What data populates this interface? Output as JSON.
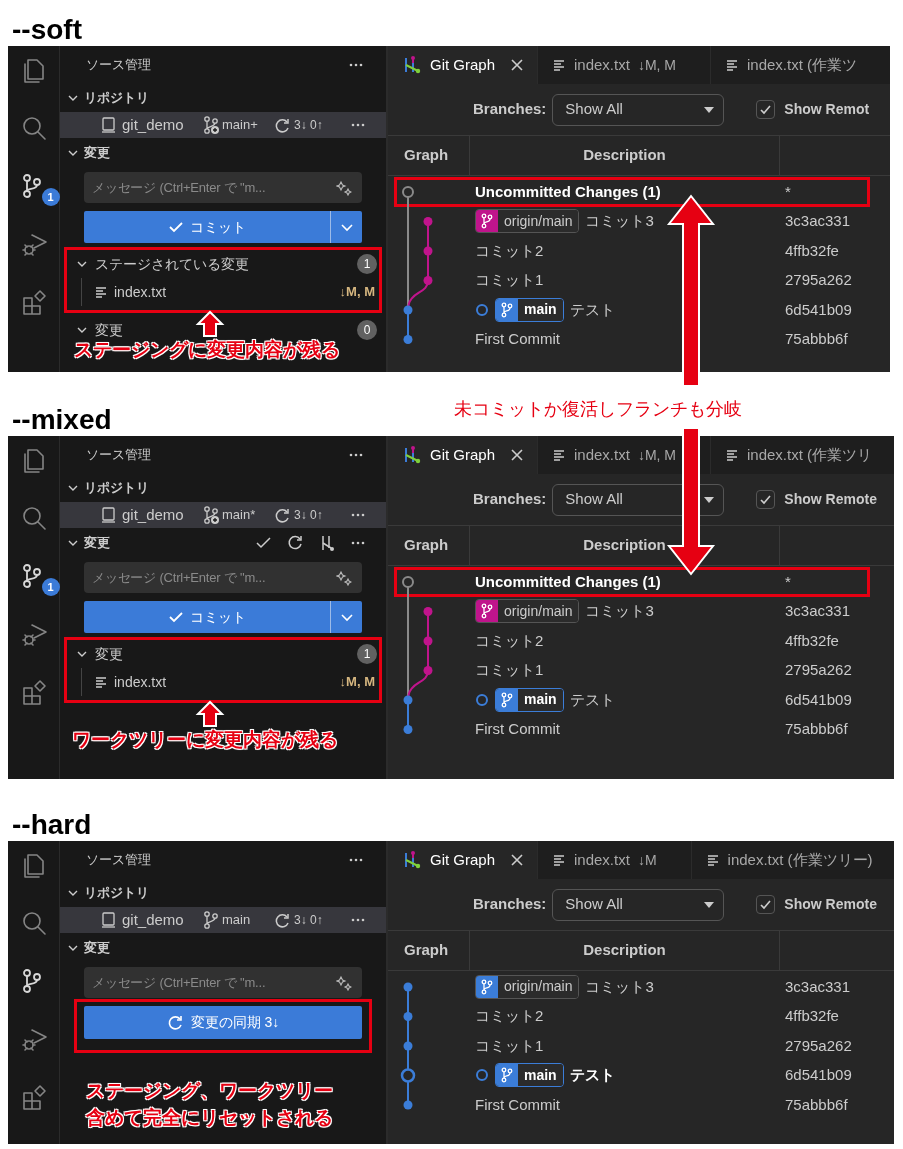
{
  "annotation": "未コミットか復活しフランチも分岐",
  "sections": [
    {
      "heading": "--soft",
      "activity_badge": "1",
      "sidebar": {
        "title": "ソース管理",
        "repositories_header": "リポジトリ",
        "repo": {
          "name": "git_demo",
          "branch": "main+",
          "branch_dirty": true,
          "sync": "3↓ 0↑"
        },
        "changes_header": "変更",
        "header_actions": false,
        "message_placeholder": "メッセージ (Ctrl+Enter で \"m...",
        "button": {
          "kind": "commit",
          "label": "コミット",
          "highlighted": false
        },
        "groups": [
          {
            "title": "ステージされている変更",
            "count": "1",
            "highlighted": true,
            "files": [
              {
                "name": "index.txt",
                "status": "↓M, M"
              }
            ]
          },
          {
            "title": "変更",
            "count": "0",
            "highlighted": false
          }
        ],
        "note": [
          "ステージングに変更内容が残る"
        ]
      },
      "editor": {
        "graph": {
          "kind": "diverged"
        },
        "tabs": [
          {
            "kind": "graph",
            "label": "Git Graph",
            "selected": true
          },
          {
            "kind": "file",
            "label": "index.txt",
            "status": "↓M, M",
            "selected": false
          },
          {
            "kind": "file",
            "label": "index.txt (作業ツ",
            "selected": false
          }
        ],
        "branches_label": "Branches:",
        "branches_value": "Show All",
        "show_remote": {
          "label": "Show Remot",
          "checked": true
        },
        "columns": [
          "Graph",
          "Description"
        ],
        "rows": [
          {
            "description": "Uncommitted Changes (1)",
            "hash": "*",
            "emphasized": true,
            "highlighted": true
          },
          {
            "tag": {
              "label": "origin/main",
              "color": "#c0148c",
              "current": false
            },
            "description": "コミット3",
            "hash": "3c3ac331",
            "emphasized": false,
            "highlighted": false
          },
          {
            "description": "コミット2",
            "hash": "4ffb32fe",
            "emphasized": false,
            "highlighted": false
          },
          {
            "description": "コミット1",
            "hash": "2795a262",
            "emphasized": false,
            "highlighted": false
          },
          {
            "tag": {
              "label": "main",
              "color": "#3b7dd8",
              "current": true
            },
            "description": "テスト",
            "hash": "6d541b09",
            "emphasized": false,
            "highlighted": false
          },
          {
            "description": "First Commit",
            "hash": "75abbb6f",
            "emphasized": false,
            "highlighted": false
          }
        ]
      }
    },
    {
      "heading": "--mixed",
      "activity_badge": "1",
      "sidebar": {
        "title": "ソース管理",
        "repositories_header": "リポジトリ",
        "repo": {
          "name": "git_demo",
          "branch": "main*",
          "branch_dirty": true,
          "sync": "3↓ 0↑"
        },
        "changes_header": "変更",
        "header_actions": true,
        "message_placeholder": "メッセージ (Ctrl+Enter で \"m...",
        "button": {
          "kind": "commit",
          "label": "コミット",
          "highlighted": false
        },
        "groups": [
          {
            "title": "変更",
            "count": "1",
            "highlighted": true,
            "files": [
              {
                "name": "index.txt",
                "status": "↓M, M"
              }
            ]
          }
        ],
        "note": [
          "ワークツリーに変更内容が残る"
        ]
      },
      "editor": {
        "graph": {
          "kind": "diverged"
        },
        "tabs": [
          {
            "kind": "graph",
            "label": "Git Graph",
            "selected": true
          },
          {
            "kind": "file",
            "label": "index.txt",
            "status": "↓M, M",
            "selected": false
          },
          {
            "kind": "file",
            "label": "index.txt (作業ツリ",
            "selected": false
          }
        ],
        "branches_label": "Branches:",
        "branches_value": "Show All",
        "show_remote": {
          "label": "Show Remote",
          "checked": true
        },
        "columns": [
          "Graph",
          "Description"
        ],
        "rows": [
          {
            "description": "Uncommitted Changes (1)",
            "hash": "*",
            "emphasized": true,
            "highlighted": true
          },
          {
            "tag": {
              "label": "origin/main",
              "color": "#c0148c",
              "current": false
            },
            "description": "コミット3",
            "hash": "3c3ac331",
            "emphasized": false,
            "highlighted": false
          },
          {
            "description": "コミット2",
            "hash": "4ffb32fe",
            "emphasized": false,
            "highlighted": false
          },
          {
            "description": "コミット1",
            "hash": "2795a262",
            "emphasized": false,
            "highlighted": false
          },
          {
            "tag": {
              "label": "main",
              "color": "#3b7dd8",
              "current": true
            },
            "description": "テスト",
            "hash": "6d541b09",
            "emphasized": false,
            "highlighted": false
          },
          {
            "description": "First Commit",
            "hash": "75abbb6f",
            "emphasized": false,
            "highlighted": false
          }
        ]
      }
    },
    {
      "heading": "--hard",
      "sidebar": {
        "title": "ソース管理",
        "repositories_header": "リポジトリ",
        "repo": {
          "name": "git_demo",
          "branch": "main",
          "branch_dirty": false,
          "sync": "3↓ 0↑"
        },
        "changes_header": "変更",
        "header_actions": false,
        "message_placeholder": "メッセージ (Ctrl+Enter で \"m...",
        "button": {
          "kind": "sync",
          "label": "変更の同期 3↓",
          "highlighted": true
        },
        "note": [
          "ステージング、ワークツリー",
          "含めて完全にリセットされる"
        ]
      },
      "editor": {
        "graph": {
          "kind": "linear"
        },
        "tabs": [
          {
            "kind": "graph",
            "label": "Git Graph",
            "selected": true
          },
          {
            "kind": "file",
            "label": "index.txt",
            "status": "↓M",
            "selected": false
          },
          {
            "kind": "file",
            "label": "index.txt (作業ツリー)",
            "selected": false
          }
        ],
        "branches_label": "Branches:",
        "branches_value": "Show All",
        "show_remote": {
          "label": "Show Remote",
          "checked": true
        },
        "columns": [
          "Graph",
          "Description"
        ],
        "rows": [
          {
            "tag": {
              "label": "origin/main",
              "color": "#3b7dd8",
              "current": false
            },
            "description": "コミット3",
            "hash": "3c3ac331",
            "emphasized": false,
            "highlighted": false
          },
          {
            "description": "コミット2",
            "hash": "4ffb32fe",
            "emphasized": false,
            "highlighted": false
          },
          {
            "description": "コミット1",
            "hash": "2795a262",
            "emphasized": false,
            "highlighted": false
          },
          {
            "tag": {
              "label": "main",
              "color": "#3b7dd8",
              "current": true
            },
            "description": "テスト",
            "hash": "6d541b09",
            "emphasized": true,
            "highlighted": false
          },
          {
            "description": "First Commit",
            "hash": "75abbb6f",
            "emphasized": false,
            "highlighted": false
          }
        ]
      }
    }
  ]
}
